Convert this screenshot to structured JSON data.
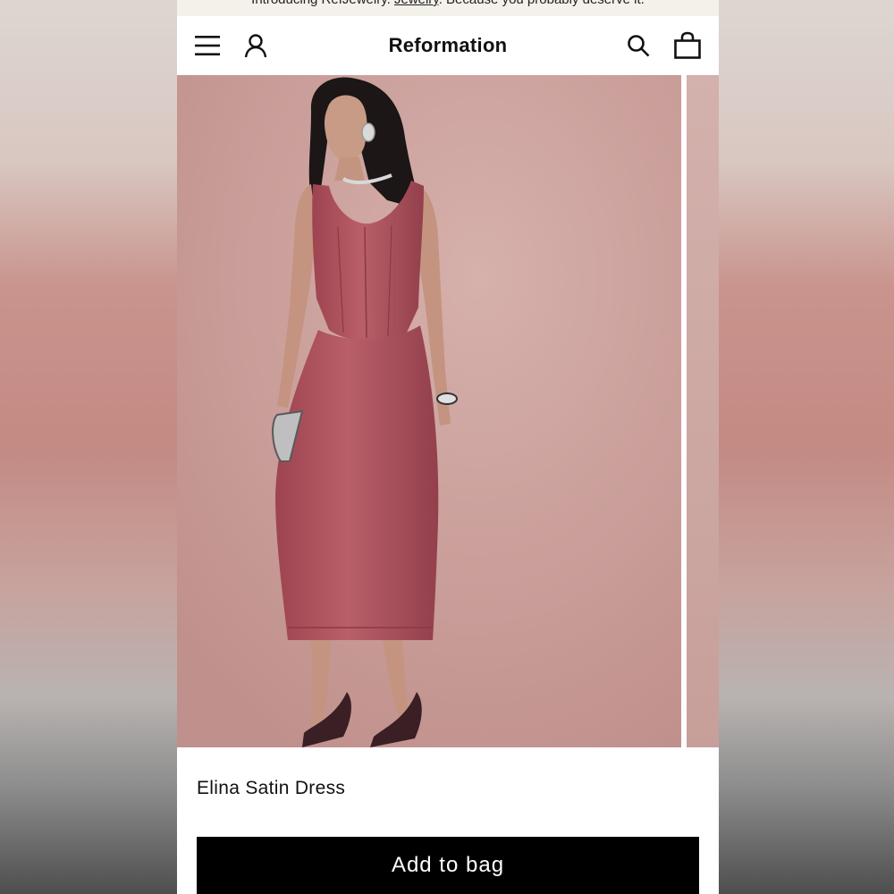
{
  "announcement": {
    "prefix": "Introducing RefJewelry. ",
    "link": "Jewelry",
    "suffix": ". Because you probably deserve it."
  },
  "header": {
    "brand": "Reformation",
    "icons": [
      "menu-icon",
      "account-icon",
      "search-icon",
      "bag-icon"
    ]
  },
  "gallery": {
    "image_alt": "Model wearing the Elina Satin Dress in a rose color",
    "dress_color": "#b3565f",
    "background_color": "#c9a09b"
  },
  "product": {
    "name": "Elina Satin Dress"
  },
  "actions": {
    "add_to_bag": "Add to bag"
  }
}
